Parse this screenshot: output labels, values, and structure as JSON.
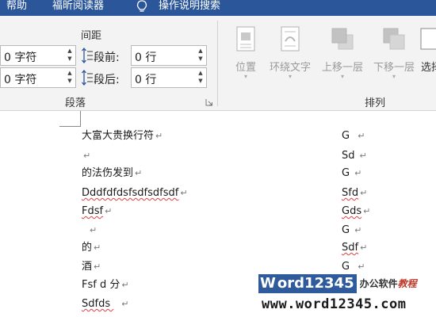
{
  "menu": {
    "help": "帮助",
    "foxit_reader": "福昕阅读器",
    "tell_me": "操作说明搜索"
  },
  "paragraph_group": {
    "section_heading": "间距",
    "indent_left_value": "0 字符",
    "indent_right_value": "0 字符",
    "space_before_label": "段前:",
    "space_before_value": "0 行",
    "space_after_label": "段后:",
    "space_after_value": "0 行",
    "group_label": "段落"
  },
  "arrange_group": {
    "group_label": "排列",
    "buttons": {
      "position": "位置",
      "wrap_text": "环绕文字",
      "bring_forward": "上移一层",
      "send_backward": "下移一层",
      "selection_pane": "选择"
    }
  },
  "document": {
    "paragraph_mark": "↵",
    "left_lines": [
      "大富大贵换行符",
      "",
      "的法伤发到",
      "Dddfdfdsfsdfsdfsdf",
      "Fdsf",
      "",
      "的",
      "酒",
      "Fsf d 分",
      "Sdfds "
    ],
    "right_lines": [
      "G ",
      "Sd",
      "G",
      "Sfd",
      "Gds",
      "G",
      "Sdf",
      "G "
    ]
  },
  "watermark": {
    "logo_w": "W",
    "logo_rest": "ord12345",
    "logo_cn": "办公软件",
    "logo_cn2": "教程",
    "url": "www.word12345.com"
  },
  "colors": {
    "title_bar": "#2b579a",
    "ribbon_bg": "#f3f3f3",
    "spell_underline": "#e04040",
    "logo_bg": "#2f5b9c"
  }
}
